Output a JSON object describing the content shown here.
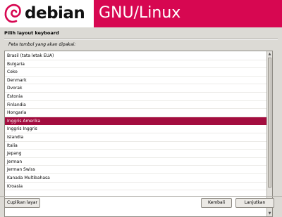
{
  "banner": {
    "logo_text": "debian",
    "os_name": "GNU/Linux",
    "colors": {
      "banner": "#d70751",
      "selection": "#a30d3f"
    }
  },
  "page": {
    "heading": "Pilih layout keyboard",
    "instruction": "Peta tombol yang akan dipakai:"
  },
  "layouts": {
    "items": [
      "Brasil (tata letak EUA)",
      "Bulgaria",
      "Ceko",
      "Denmark",
      "Dvorak",
      "Estonia",
      "Finlandia",
      "Hongaria",
      "Inggris Amerika",
      "Inggris Inggris",
      "Islandia",
      "Italia",
      "Jepang",
      "Jerman",
      "Jerman Swiss",
      "Kanada Multibahasa",
      "Kroasia"
    ],
    "selected": "Inggris Amerika"
  },
  "buttons": {
    "screenshot": "Cuplikan layar",
    "back": "Kembali",
    "next": "Lanjutkan"
  },
  "icons": {
    "scroll_up": "scroll-up-arrow-icon",
    "scroll_down": "scroll-down-arrow-icon",
    "logo": "debian-swirl-icon"
  }
}
